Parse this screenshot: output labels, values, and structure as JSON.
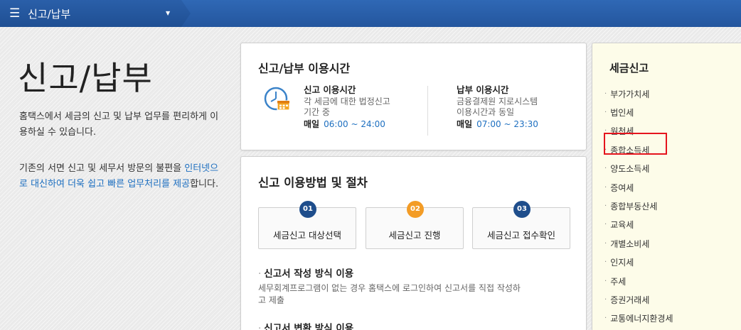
{
  "nav": {
    "menu_icon": "☰",
    "title": "신고/납부",
    "caret": "▼"
  },
  "intro": {
    "title": "신고/납부",
    "desc1": "홈택스에서 세금의 신고 및 납부 업무를 편리하게 이용하실 수 있습니다.",
    "desc2_a": "기존의 서면 신고 및 세무서 방문의 불편을 ",
    "desc2_b": "인터넷으로 대신하여 더욱 쉽고 빠른 업무처리를 제공",
    "desc2_c": "합니다."
  },
  "hours": {
    "title": "신고/납부 이용시간",
    "icon": "clock-calendar-icon",
    "filing": {
      "title": "신고 이용시간",
      "desc1": "각 세금에 대한 법정신고",
      "desc2": "기간 중",
      "daily": "매일",
      "time": "06:00 ~ 24:00"
    },
    "payment": {
      "title": "납부 이용시간",
      "desc1": "금융결제원 지로시스템",
      "desc2": "이용시간과 동일",
      "daily": "매일",
      "time": "07:00 ~ 23:30"
    }
  },
  "procedure": {
    "title": "신고 이용방법 및 절차",
    "steps": [
      {
        "num": "01",
        "label": "세금신고 대상선택",
        "color": "#1f4e8c"
      },
      {
        "num": "02",
        "label": "세금신고 진행",
        "color": "#f39c26"
      },
      {
        "num": "03",
        "label": "세금신고 접수확인",
        "color": "#1f4e8c"
      }
    ],
    "methods": [
      {
        "title": "신고서 작성 방식 이용",
        "desc": "세무회계프로그램이 없는 경우 홈택스에 로그인하여 신고서를 직접 작성하고 제출"
      },
      {
        "title": "신고서 변환 방식 이용",
        "desc": ""
      }
    ]
  },
  "tax": {
    "title": "세금신고",
    "bullet": "·",
    "items": [
      "부가가치세",
      "법인세",
      "원천세",
      "종합소득세",
      "양도소득세",
      "증여세",
      "종합부동산세",
      "교육세",
      "개별소비세",
      "인지세",
      "주세",
      "증권거래세",
      "교통에너지환경세"
    ],
    "highlighted_item": "종합소득세"
  },
  "colors": {
    "topbar": "#2a5fa9",
    "link_blue": "#1d6fc0",
    "highlight_red": "#e5141d",
    "tax_panel_bg": "#fdfce9"
  }
}
